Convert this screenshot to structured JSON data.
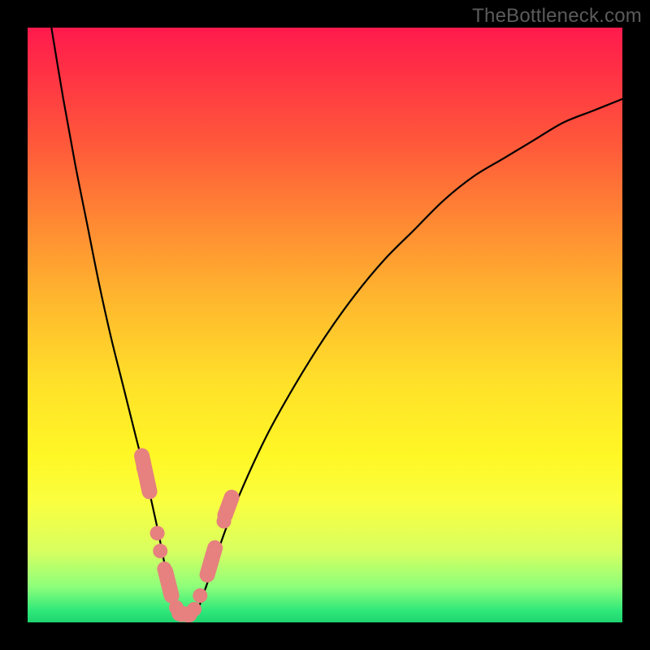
{
  "watermark": "TheBottleneck.com",
  "chart_data": {
    "type": "line",
    "title": "",
    "xlabel": "",
    "ylabel": "",
    "xlim": [
      0,
      100
    ],
    "ylim": [
      0,
      100
    ],
    "annotations": [],
    "series": [
      {
        "name": "bottleneck-curve",
        "x": [
          4,
          6,
          8,
          10,
          12,
          14,
          16,
          18,
          20,
          22,
          23,
          24,
          25,
          26,
          28,
          30,
          32,
          35,
          40,
          45,
          50,
          55,
          60,
          65,
          70,
          75,
          80,
          85,
          90,
          95,
          100
        ],
        "values": [
          100,
          88,
          77,
          67,
          57,
          48,
          40,
          32,
          24,
          15,
          10,
          6,
          3,
          1,
          1,
          6,
          12,
          20,
          31,
          40,
          48,
          55,
          61,
          66,
          71,
          75,
          78,
          81,
          84,
          86,
          88
        ]
      }
    ],
    "markers": {
      "name": "highlight-dots",
      "points": [
        {
          "x": 19.5,
          "y": 26
        },
        {
          "x": 20.2,
          "y": 23
        },
        {
          "x": 21.8,
          "y": 15
        },
        {
          "x": 22.3,
          "y": 12
        },
        {
          "x": 23.0,
          "y": 9
        },
        {
          "x": 24.0,
          "y": 5
        },
        {
          "x": 25.0,
          "y": 2.5
        },
        {
          "x": 25.8,
          "y": 1.3
        },
        {
          "x": 27.0,
          "y": 1.2
        },
        {
          "x": 28.0,
          "y": 2.2
        },
        {
          "x": 29.0,
          "y": 4.5
        },
        {
          "x": 30.5,
          "y": 9
        },
        {
          "x": 31.2,
          "y": 11.5
        },
        {
          "x": 33.0,
          "y": 17
        },
        {
          "x": 34.0,
          "y": 20
        }
      ],
      "capsules": [
        {
          "x1": 19.2,
          "y1": 28,
          "x2": 20.5,
          "y2": 22
        },
        {
          "x1": 23.2,
          "y1": 8.5,
          "x2": 24.2,
          "y2": 4.5
        },
        {
          "x1": 25.5,
          "y1": 1.5,
          "x2": 27.2,
          "y2": 1.3
        },
        {
          "x1": 30.2,
          "y1": 8,
          "x2": 31.5,
          "y2": 12.5
        },
        {
          "x1": 33.2,
          "y1": 18,
          "x2": 34.3,
          "y2": 21
        }
      ]
    },
    "gradient_stops": [
      {
        "pos": 0,
        "color": "#ff1a4d"
      },
      {
        "pos": 20,
        "color": "#ff5a3a"
      },
      {
        "pos": 46,
        "color": "#ffb82e"
      },
      {
        "pos": 72,
        "color": "#fff726"
      },
      {
        "pos": 94,
        "color": "#8dff7a"
      },
      {
        "pos": 100,
        "color": "#1ed470"
      }
    ]
  }
}
